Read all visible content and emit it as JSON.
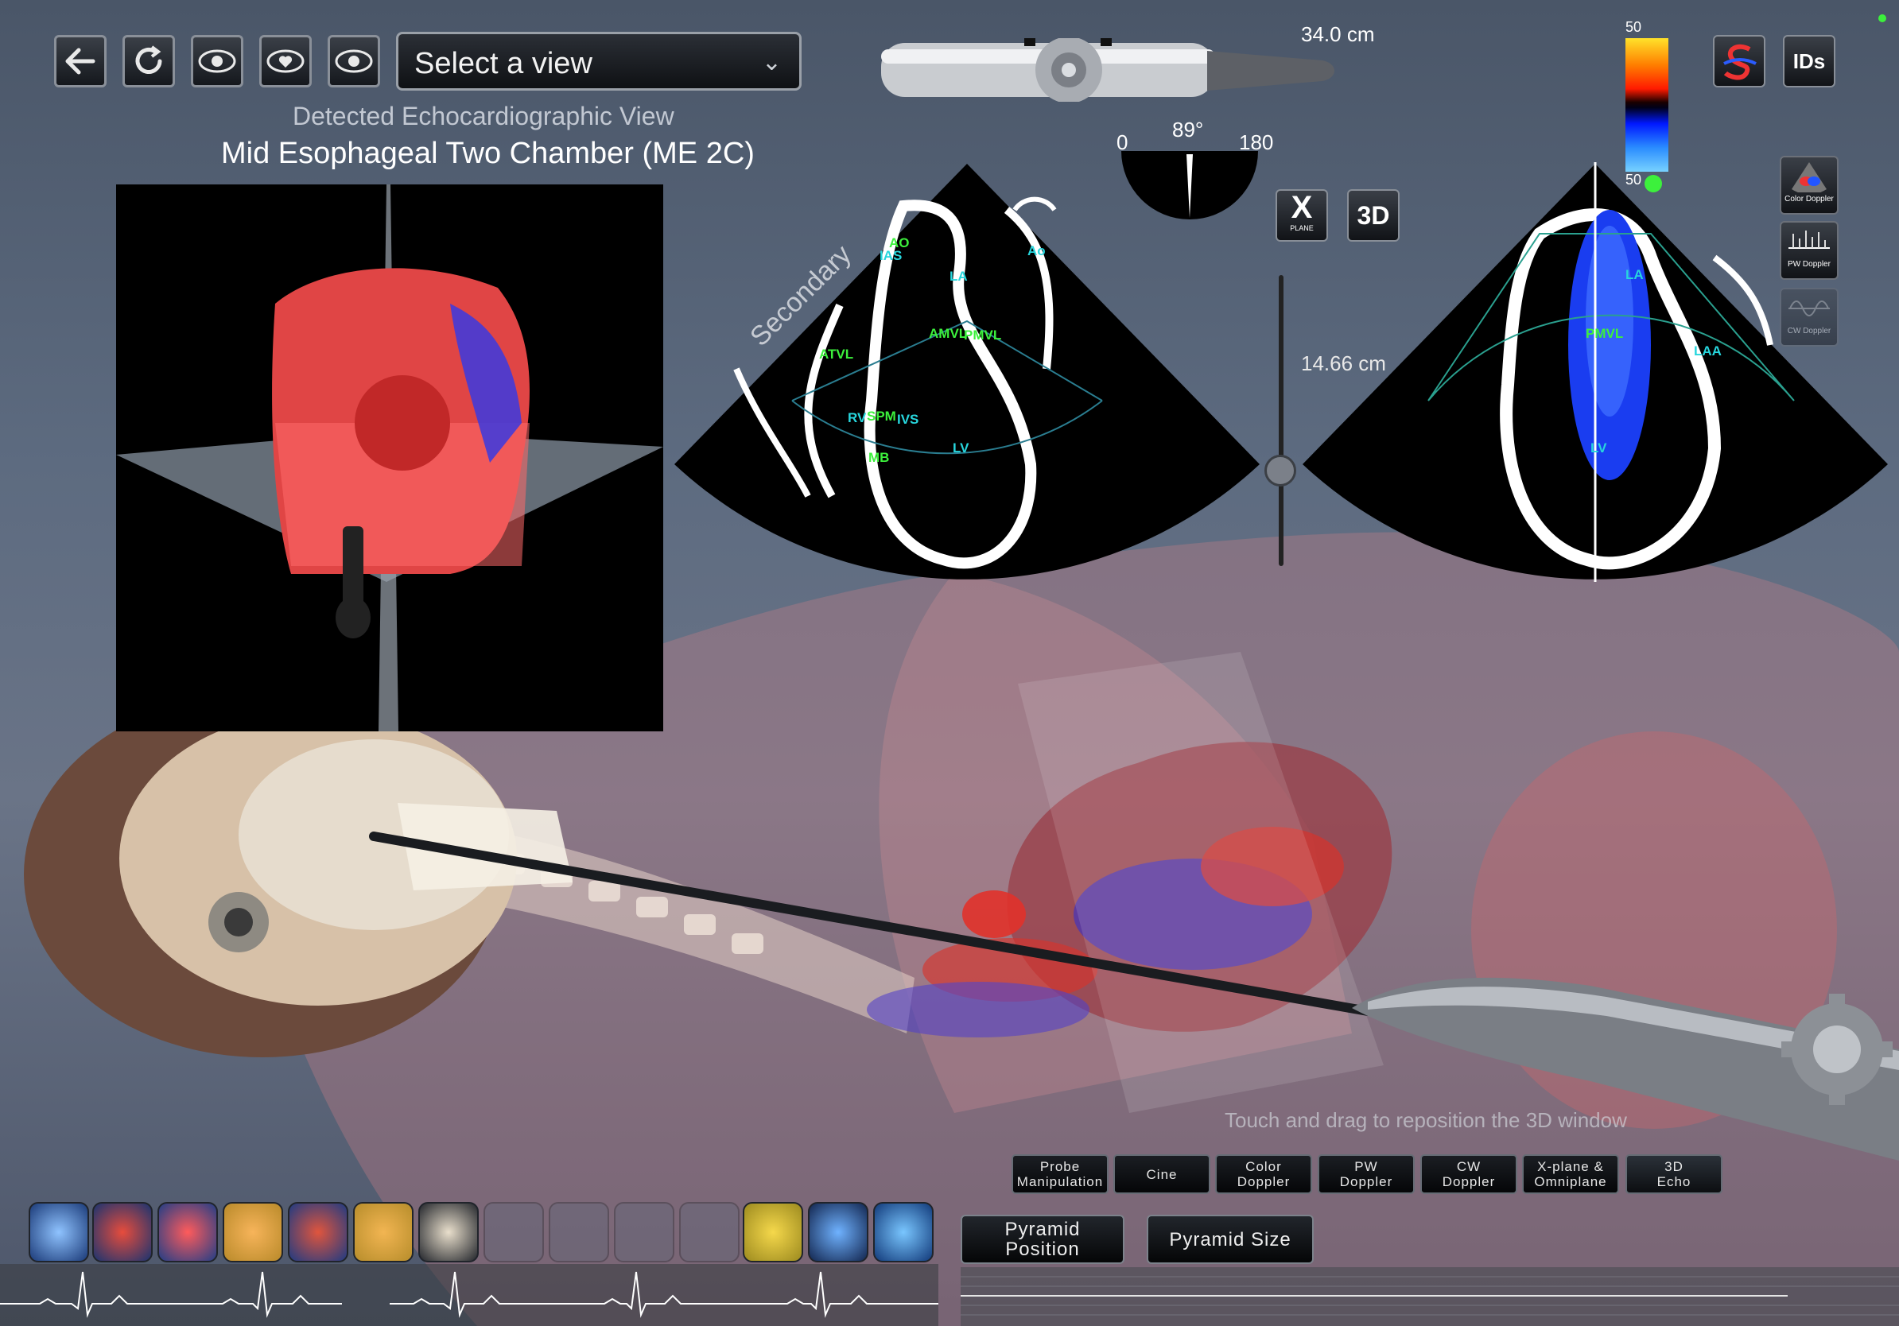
{
  "toolbar": {
    "back_icon": "arrow-left-icon",
    "reset_icon": "refresh-icon",
    "view_icons": [
      "eye-icon",
      "eye-heart-icon",
      "eye-icon"
    ],
    "select_view": "Select a view"
  },
  "detected": {
    "caption": "Detected Echocardiographic View",
    "view_name": "Mid Esophageal Two Chamber (ME 2C)"
  },
  "probe": {
    "depth_label": "34.0 cm",
    "angle_min": "0",
    "angle_value": "89°",
    "angle_max": "180",
    "depth_slider_label": "14.66 cm",
    "xplane_label": "X",
    "xplane_sublabel": "PLANE",
    "three_d_label": "3D"
  },
  "color_scale": {
    "top": "50",
    "bottom": "50"
  },
  "top_right": {
    "ids_label": "IDs"
  },
  "side_tools": [
    {
      "label": "Color Doppler"
    },
    {
      "label": "PW Doppler"
    },
    {
      "label": "CW Doppler"
    }
  ],
  "echo_primary": {
    "watermark": "Secondary",
    "labels": {
      "ao": "AO",
      "ias": "IAS",
      "ao2": "Ao",
      "la": "LA",
      "amvl": "AMVL",
      "pmvl": "PMVL",
      "atvl": "ATVL",
      "rv": "RV",
      "spm": "SPM",
      "ivs": "IVS",
      "mb": "MB",
      "lv": "LV"
    }
  },
  "echo_secondary": {
    "labels": {
      "la": "LA",
      "pmvl": "PMVL",
      "laa": "LAA",
      "lv": "LV"
    }
  },
  "hint": "Touch and drag to reposition the 3D window",
  "mode_buttons": [
    {
      "line1": "Probe",
      "line2": "Manipulation"
    },
    {
      "line1": "Cine",
      "line2": ""
    },
    {
      "line1": "Color",
      "line2": "Doppler"
    },
    {
      "line1": "PW",
      "line2": "Doppler"
    },
    {
      "line1": "CW",
      "line2": "Doppler"
    },
    {
      "line1": "X-plane &",
      "line2": "Omniplane"
    },
    {
      "line1": "3D",
      "line2": "Echo"
    }
  ],
  "pyramid": {
    "position_line1": "Pyramid",
    "position_line2": "Position",
    "size": "Pyramid Size"
  },
  "dock_icons": [
    "heart-model-icon",
    "heart-rotate-icon",
    "heart-beat-icon",
    "heart-hand-icon",
    "heart-anatomy-icon",
    "heart-search-icon",
    "valve-checklist-icon",
    "faded-icon-1",
    "faded-icon-2",
    "faded-icon-3",
    "faded-icon-4",
    "gauge-icon",
    "syringe-icon",
    "cube-3d-icon"
  ],
  "colors": {
    "accent_green": "#3cf03c",
    "label_cyan": "#27d6dd",
    "flow_red": "#e8372f",
    "flow_blue": "#3a3af0"
  }
}
